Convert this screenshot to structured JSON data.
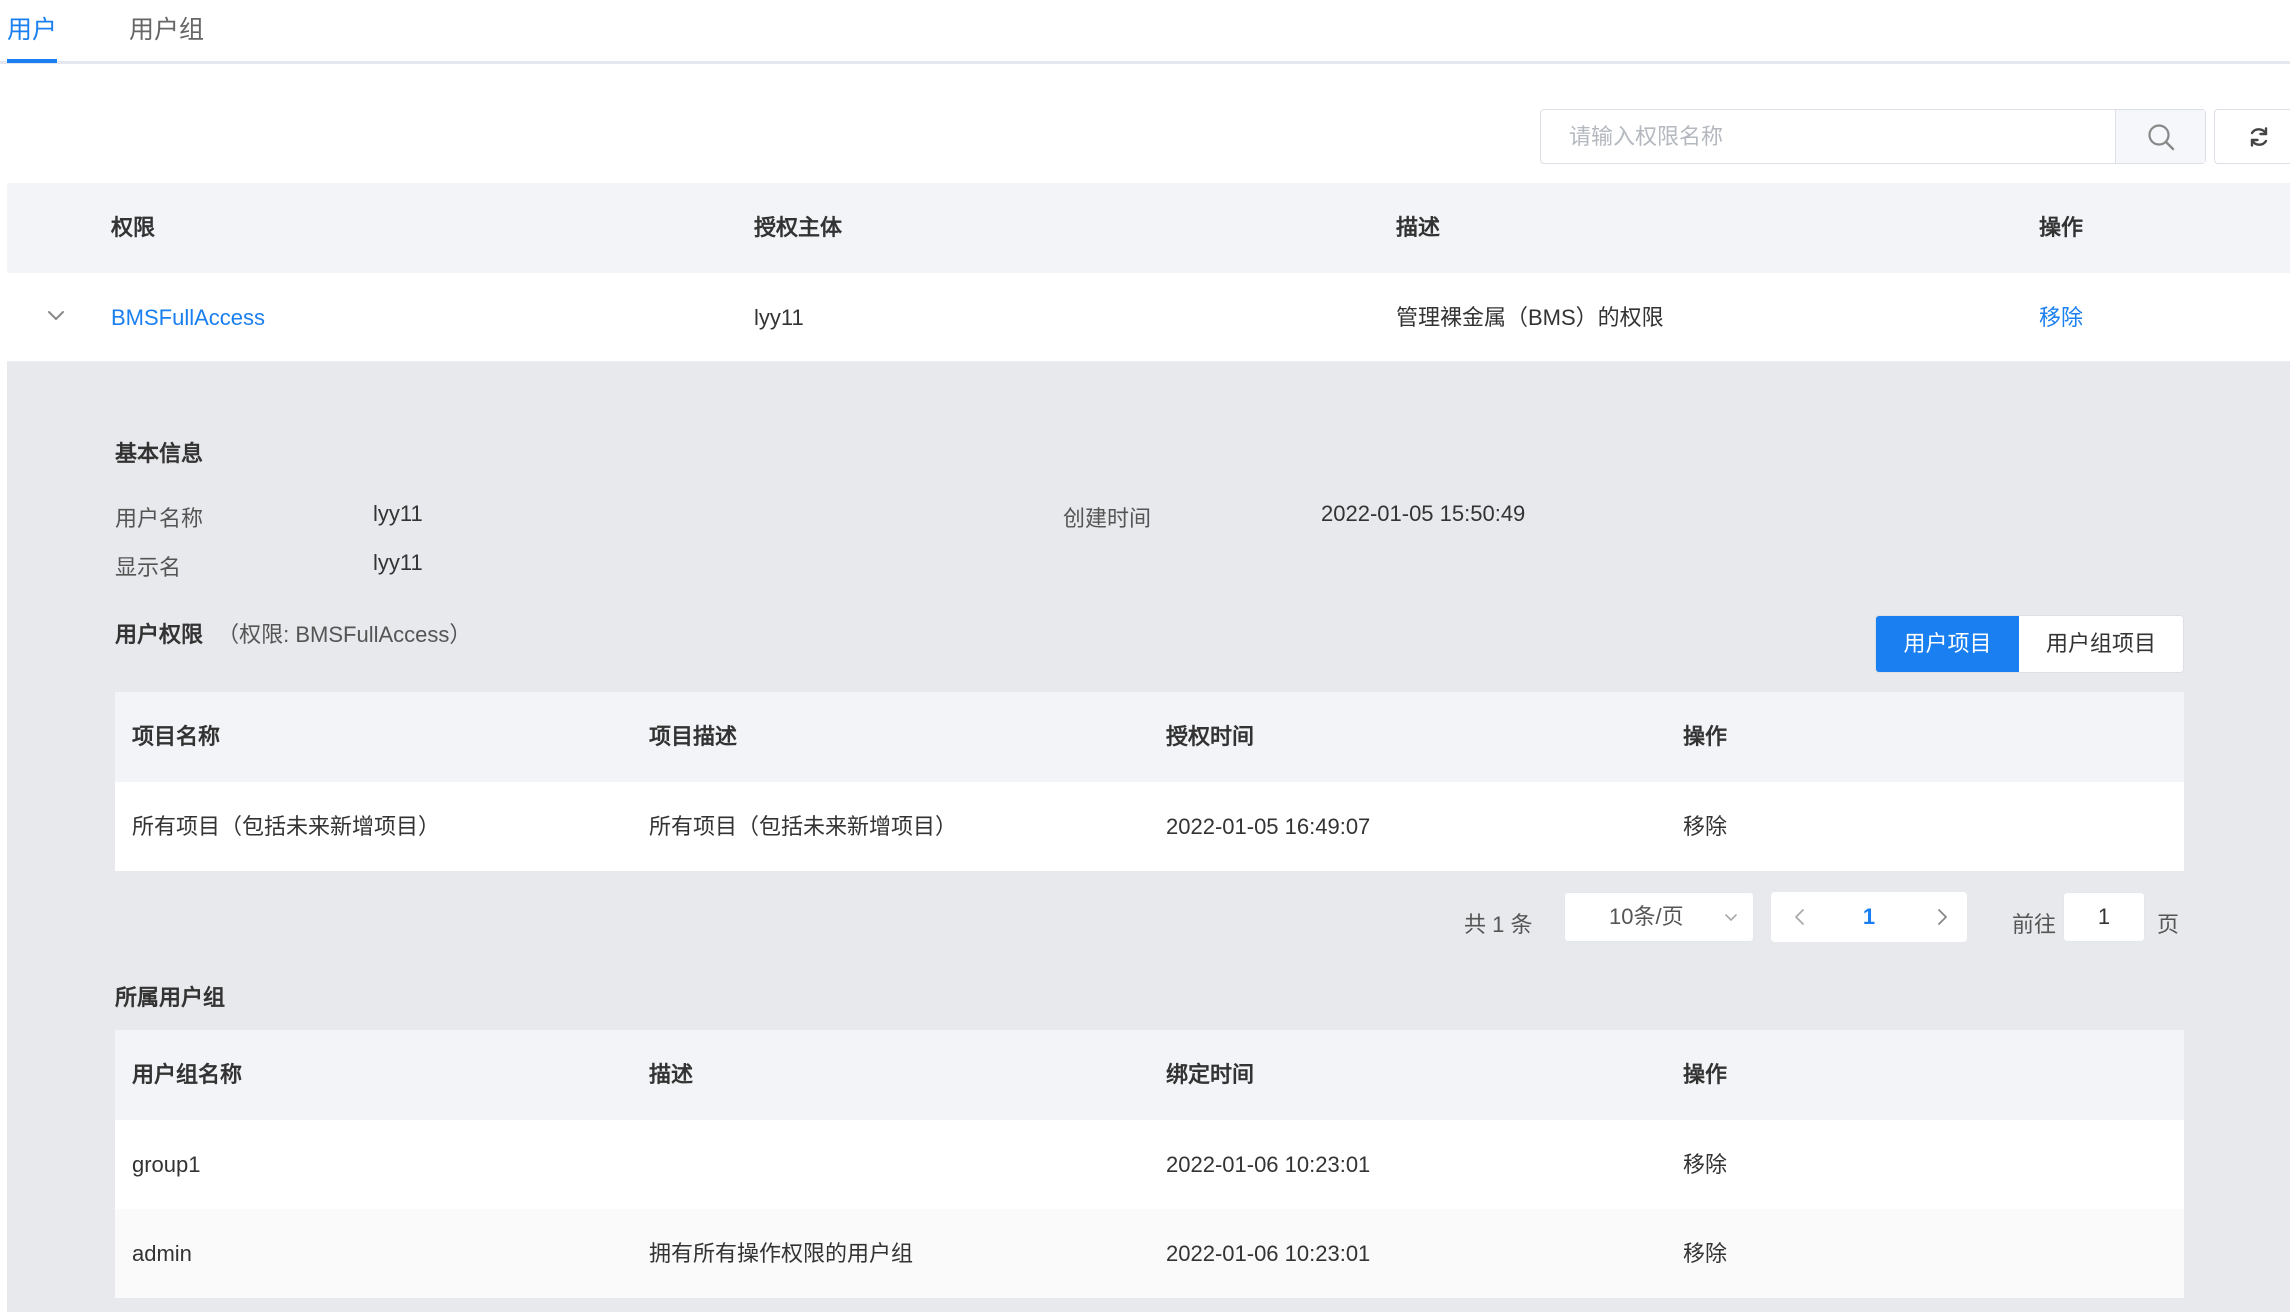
{
  "tabs": [
    {
      "label": "用户",
      "active": true
    },
    {
      "label": "用户组",
      "active": false
    }
  ],
  "search": {
    "placeholder": "请输入权限名称"
  },
  "main_table": {
    "headers": [
      "权限",
      "授权主体",
      "描述",
      "操作"
    ],
    "rows": [
      {
        "permission": "BMSFullAccess",
        "principal": "lyy11",
        "description": "管理裸金属（BMS）的权限",
        "action": "移除"
      }
    ]
  },
  "detail": {
    "basic_info_title": "基本信息",
    "fields": {
      "username_label": "用户名称",
      "username_value": "lyy11",
      "created_label": "创建时间",
      "created_value": "2022-01-05 15:50:49",
      "display_label": "显示名",
      "display_value": "lyy11"
    },
    "user_perm_title": "用户权限",
    "user_perm_note": "（权限: BMSFullAccess）",
    "segment": {
      "user_projects": "用户项目",
      "group_projects": "用户组项目",
      "selected": "用户项目"
    },
    "projects_table": {
      "headers": [
        "项目名称",
        "项目描述",
        "授权时间",
        "操作"
      ],
      "rows": [
        {
          "name": "所有项目（包括未来新增项目）",
          "description": "所有项目（包括未来新增项目）",
          "time": "2022-01-05 16:49:07",
          "action": "移除"
        }
      ]
    },
    "pagination": {
      "total_text": "共 1 条",
      "page_size": "10条/页",
      "current_page": "1",
      "goto_label": "前往",
      "goto_value": "1",
      "page_suffix": "页"
    },
    "groups_title": "所属用户组",
    "groups_table": {
      "headers": [
        "用户组名称",
        "描述",
        "绑定时间",
        "操作"
      ],
      "rows": [
        {
          "name": "group1",
          "description": "",
          "time": "2022-01-06 10:23:01",
          "action": "移除"
        },
        {
          "name": "admin",
          "description": "拥有所有操作权限的用户组",
          "time": "2022-01-06 10:23:01",
          "action": "移除"
        }
      ]
    }
  },
  "colors": {
    "accent": "#1a7ff0",
    "panel_bg": "#e8e9ed",
    "header_bg": "#f2f4f7"
  },
  "icons": [
    "search-icon",
    "refresh-icon",
    "chevron-down-icon",
    "chevron-left-icon",
    "chevron-right-icon"
  ]
}
